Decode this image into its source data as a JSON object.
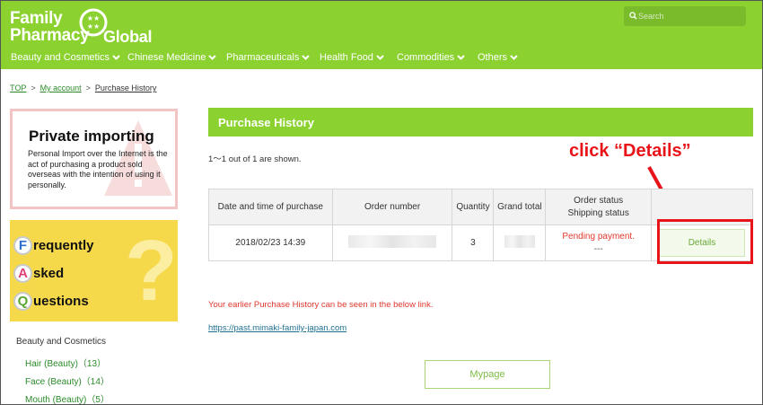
{
  "header": {
    "logo": {
      "line1": "Family",
      "line2": "Pharmacy",
      "line3": "Global",
      "mark": "star-circle-logo-icon"
    },
    "search": {
      "placeholder": "Search",
      "icon": "search-icon"
    },
    "nav": [
      {
        "label": "Beauty and Cosmetics"
      },
      {
        "label": "Chinese Medicine"
      },
      {
        "label": "Pharmaceuticals"
      },
      {
        "label": "Health Food"
      },
      {
        "label": "Commodities"
      },
      {
        "label": "Others"
      }
    ]
  },
  "breadcrumb": {
    "top": "TOP",
    "sep": ">",
    "account": "My account",
    "current": "Purchase History"
  },
  "sidebar": {
    "import_banner": {
      "title": "Private importing",
      "desc": "Personal Import over the Internet is the act of purchasing a product sold overseas with the intention of using it personally."
    },
    "faq_banner": {
      "rows": [
        {
          "letter": "F",
          "rest": "requently",
          "color": "#2f6fd0"
        },
        {
          "letter": "A",
          "rest": "sked",
          "color": "#e0407a"
        },
        {
          "letter": "Q",
          "rest": "uestions",
          "color": "#5aa832"
        }
      ],
      "qmark": "?"
    },
    "category": "Beauty and Cosmetics",
    "items": [
      {
        "label": "Hair (Beauty)（13）"
      },
      {
        "label": "Face (Beauty)（14）"
      },
      {
        "label": "Mouth (Beauty)（5）"
      }
    ]
  },
  "main": {
    "title": "Purchase History",
    "count_text": "1〜1 out of 1 are shown.",
    "callout": "click “Details”",
    "table": {
      "headers": {
        "date": "Date and time of purchase",
        "order": "Order number",
        "qty": "Quantity",
        "total": "Grand total",
        "status1": "Order status",
        "status2": "Shipping status"
      },
      "rows": [
        {
          "date": "2018/02/23 14:39",
          "qty": "3",
          "order_status": "Pending payment.",
          "ship_status": "---",
          "details_label": "Details"
        }
      ]
    },
    "notice": "Your earlier Purchase History can be seen in the below link.",
    "past_link": "https://past.mimaki-family-japan.com",
    "mypage_label": "Mypage"
  },
  "colors": {
    "brand_green": "#8bd130",
    "alert_red": "#e8141a",
    "link_green": "#2a8a2a"
  }
}
